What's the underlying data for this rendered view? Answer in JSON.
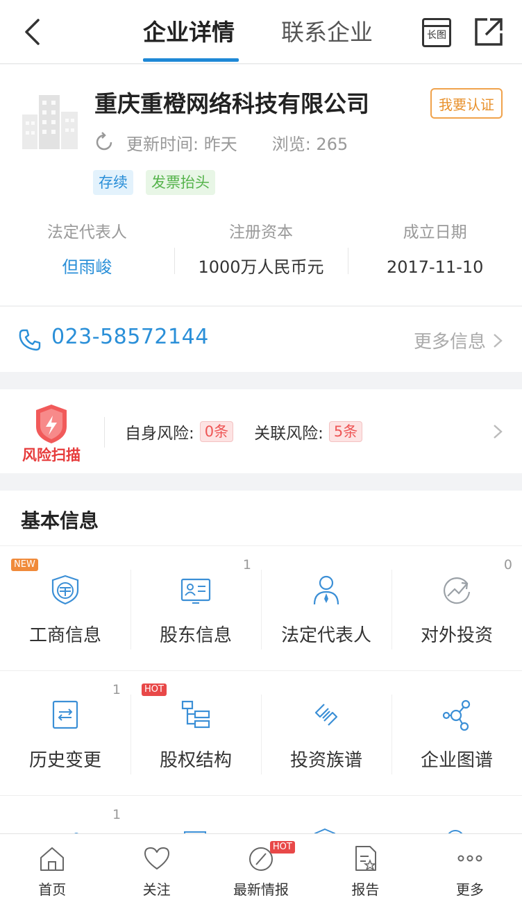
{
  "header": {
    "tabs": [
      "企业详情",
      "联系企业"
    ],
    "long_image_label": "长图"
  },
  "company": {
    "name": "重庆重橙网络科技有限公司",
    "verify_label": "我要认证",
    "update_text": "更新时间: 昨天",
    "views_text": "浏览: 265",
    "tags": [
      "存续",
      "发票抬头"
    ],
    "info": [
      {
        "label": "法定代表人",
        "value": "但雨峻"
      },
      {
        "label": "注册资本",
        "value": "1000万人民币元"
      },
      {
        "label": "成立日期",
        "value": "2017-11-10"
      }
    ]
  },
  "contact": {
    "phone": "023-58572144",
    "more_label": "更多信息"
  },
  "risk": {
    "logo_text": "风险扫描",
    "self_label": "自身风险:",
    "self_value": "0条",
    "related_label": "关联风险:",
    "related_value": "5条"
  },
  "basic_info": {
    "title": "基本信息",
    "badge_new": "NEW",
    "badge_hot": "HOT",
    "items": [
      {
        "label": "工商信息",
        "icon": "business-icon",
        "count": ""
      },
      {
        "label": "股东信息",
        "icon": "shareholder-icon",
        "count": "1"
      },
      {
        "label": "法定代表人",
        "icon": "legal-person-icon",
        "count": ""
      },
      {
        "label": "对外投资",
        "icon": "investment-icon",
        "count": "0"
      },
      {
        "label": "历史变更",
        "icon": "history-icon",
        "count": "1"
      },
      {
        "label": "股权结构",
        "icon": "equity-structure-icon",
        "count": ""
      },
      {
        "label": "投资族谱",
        "icon": "investment-tree-icon",
        "count": ""
      },
      {
        "label": "企业图谱",
        "icon": "enterprise-graph-icon",
        "count": ""
      }
    ],
    "partial_count": "1"
  },
  "bottom_nav": {
    "items": [
      "首页",
      "关注",
      "最新情报",
      "报告",
      "更多"
    ],
    "hot_label": "HOT"
  },
  "colors": {
    "accent": "#1e88d6",
    "link": "#2a8fd8",
    "risk_red": "#e55",
    "verify_orange": "#e8912c"
  }
}
